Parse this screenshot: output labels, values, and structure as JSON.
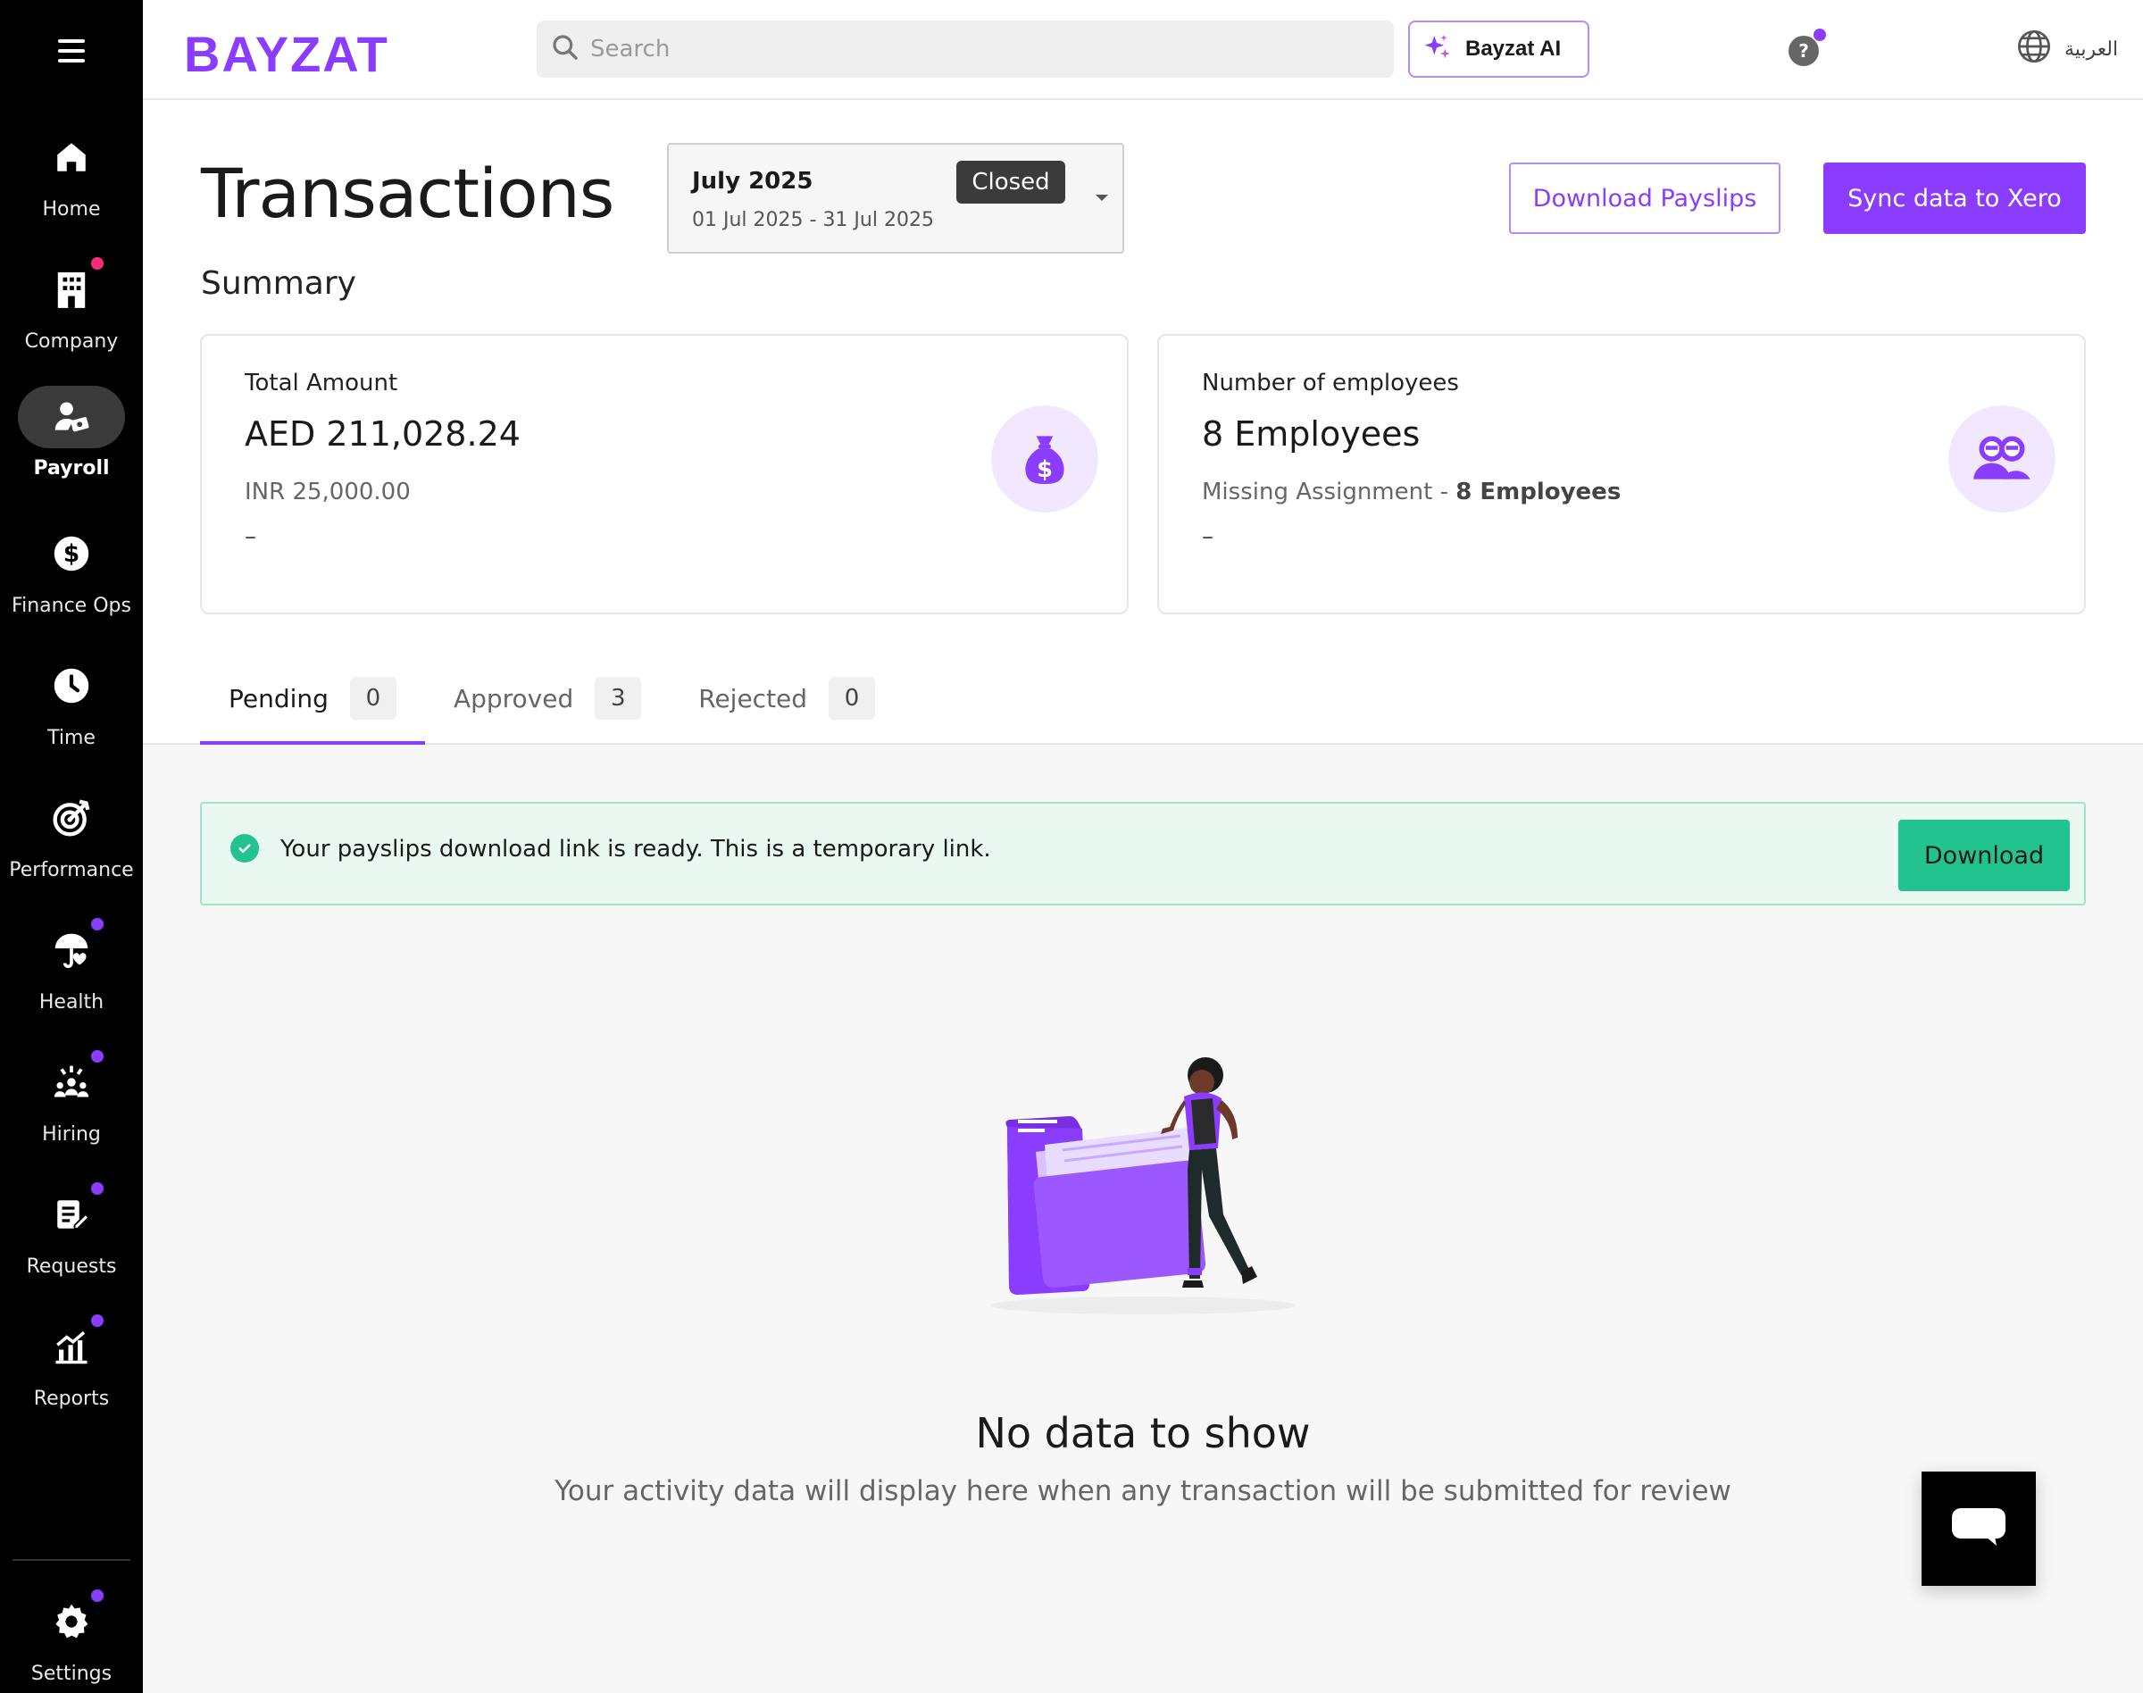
{
  "sidebar": {
    "items": [
      {
        "label": "Home",
        "icon": "home-icon"
      },
      {
        "label": "Company",
        "icon": "building-icon"
      },
      {
        "label": "Payroll",
        "icon": "payroll-icon"
      },
      {
        "label": "Finance Ops",
        "icon": "dollar-icon"
      },
      {
        "label": "Time",
        "icon": "clock-icon"
      },
      {
        "label": "Performance",
        "icon": "target-icon"
      },
      {
        "label": "Health",
        "icon": "umbrella-heart-icon"
      },
      {
        "label": "Hiring",
        "icon": "people-sparkle-icon"
      },
      {
        "label": "Requests",
        "icon": "clipboard-edit-icon"
      },
      {
        "label": "Reports",
        "icon": "chart-up-icon"
      }
    ],
    "settings_label": "Settings",
    "active_item": "Payroll"
  },
  "header": {
    "logo_text": "BAYZAT",
    "search_placeholder": "Search",
    "ai_button_label": "Bayzat AI",
    "help_label": "?",
    "language_label": "العربية"
  },
  "page": {
    "title": "Transactions",
    "period": {
      "month": "July 2025",
      "range": "01 Jul 2025 - 31 Jul 2025",
      "status": "Closed"
    },
    "actions": {
      "download_payslips": "Download Payslips",
      "sync_xero": "Sync data to Xero"
    },
    "summary_title": "Summary",
    "cards": [
      {
        "label": "Total Amount",
        "value": "AED 211,028.24",
        "sub": "INR 25,000.00",
        "dash": "–",
        "icon": "money-bag-icon"
      },
      {
        "label": "Number of employees",
        "value": "8 Employees",
        "sub_prefix": "Missing Assignment - ",
        "sub_bold": "8 Employees",
        "dash": "–",
        "icon": "people-icon"
      }
    ],
    "tabs": [
      {
        "label": "Pending",
        "count": "0"
      },
      {
        "label": "Approved",
        "count": "3"
      },
      {
        "label": "Rejected",
        "count": "0"
      }
    ],
    "active_tab": "Pending"
  },
  "banner": {
    "message": "Your payslips download link is ready. This is a temporary link.",
    "button": "Download"
  },
  "empty_state": {
    "title": "No data to show",
    "subtitle": "Your activity data will display here when any transaction will be submitted for review"
  },
  "colors": {
    "brand": "#8b3dff",
    "success": "#22c38e",
    "sidebar_bg": "#000000"
  }
}
